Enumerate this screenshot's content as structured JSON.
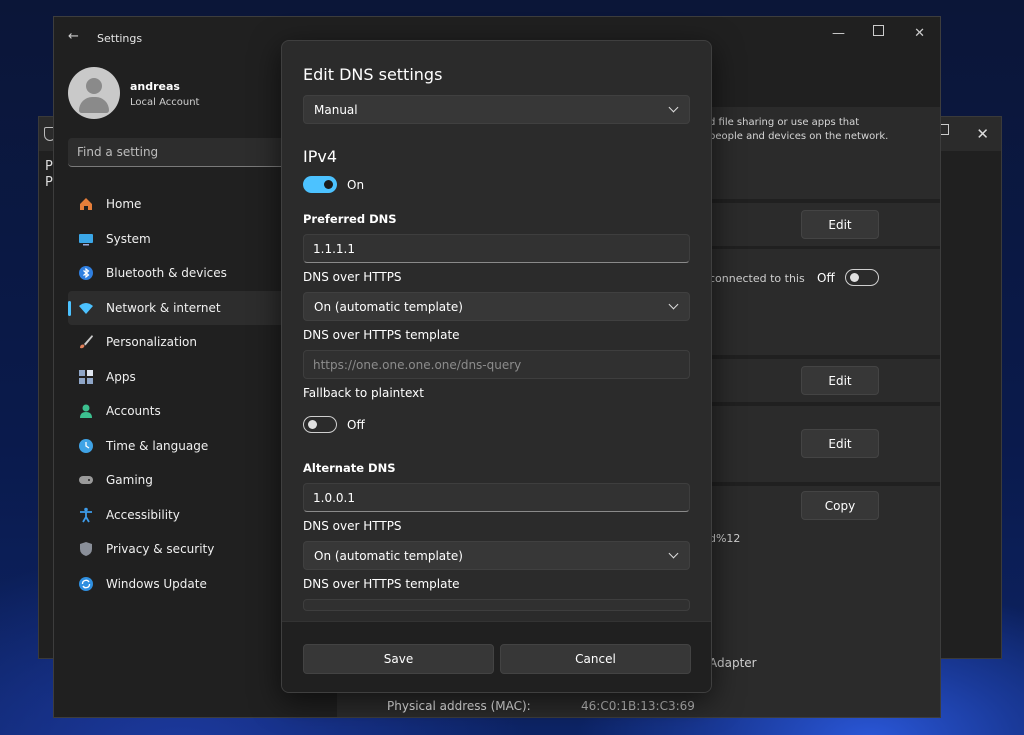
{
  "background_window": {
    "left_text": "P\nP"
  },
  "app": {
    "title": "Settings",
    "user_name": "andreas",
    "account_type": "Local Account",
    "search_placeholder": "Find a setting"
  },
  "nav": [
    {
      "label": "Home",
      "icon": "home-icon",
      "color": "#e67e3a"
    },
    {
      "label": "System",
      "icon": "monitor-icon",
      "color": "#3ba7e8"
    },
    {
      "label": "Bluetooth & devices",
      "icon": "bluetooth-icon",
      "color": "#2f7fe0"
    },
    {
      "label": "Network & internet",
      "icon": "wifi-icon",
      "color": "#4cc2ff",
      "active": true
    },
    {
      "label": "Personalization",
      "icon": "brush-icon",
      "color": "#e0805a"
    },
    {
      "label": "Apps",
      "icon": "apps-icon",
      "color": "#8fa6c8"
    },
    {
      "label": "Accounts",
      "icon": "person-icon",
      "color": "#3cc08f"
    },
    {
      "label": "Time & language",
      "icon": "globe-clock-icon",
      "color": "#3fa3e6"
    },
    {
      "label": "Gaming",
      "icon": "gamepad-icon",
      "color": "#9a9a9a"
    },
    {
      "label": "Accessibility",
      "icon": "accessibility-icon",
      "color": "#3d9be9"
    },
    {
      "label": "Privacy & security",
      "icon": "shield-icon",
      "color": "#8a8f99"
    },
    {
      "label": "Windows Update",
      "icon": "update-icon",
      "color": "#2f8fe0"
    }
  ],
  "content": {
    "desc_line1": "d file sharing or use apps that",
    "desc_line2": "people and devices on the network.",
    "edit_label": "Edit",
    "connected_text": "connected to this",
    "off_label": "Off",
    "copy_label": "Copy",
    "ipv6_suffix": "d%12",
    "adapter_text": "Adapter",
    "mac_label": "Physical address (MAC):",
    "mac_value": "46:C0:1B:13:C3:69"
  },
  "dialog": {
    "title": "Edit DNS settings",
    "mode_value": "Manual",
    "section_ipv4": "IPv4",
    "ipv4_toggle_label": "On",
    "preferred_dns_label": "Preferred DNS",
    "preferred_dns_value": "1.1.1.1",
    "doh_label": "DNS over HTTPS",
    "doh_value": "On (automatic template)",
    "doh_template_label": "DNS over HTTPS template",
    "doh_template_placeholder": "https://one.one.one.one/dns-query",
    "fallback_label": "Fallback to plaintext",
    "fallback_toggle_label": "Off",
    "alternate_dns_label": "Alternate DNS",
    "alternate_dns_value": "1.0.0.1",
    "alt_doh_label": "DNS over HTTPS",
    "alt_doh_value": "On (automatic template)",
    "alt_doh_template_label": "DNS over HTTPS template",
    "save_label": "Save",
    "cancel_label": "Cancel"
  },
  "colors": {
    "accent": "#4cc2ff",
    "window_bg": "#202020",
    "dialog_bg": "#2b2b2b"
  }
}
